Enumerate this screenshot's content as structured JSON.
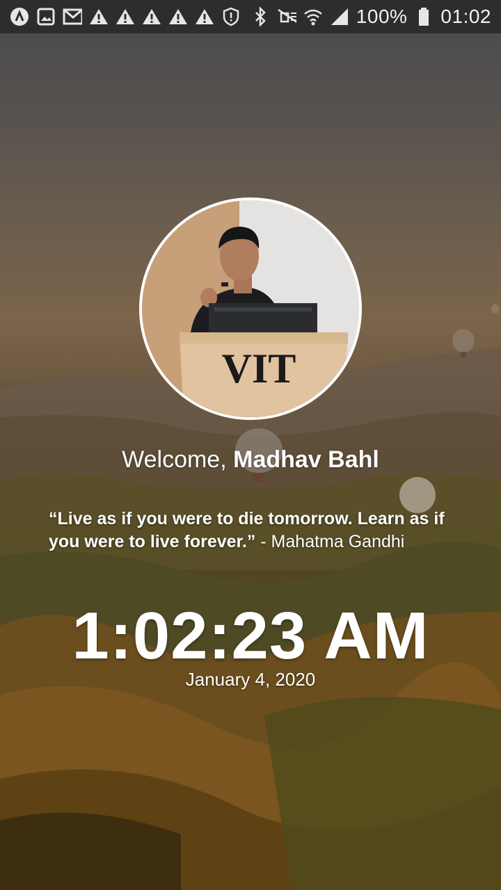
{
  "status_bar": {
    "battery": "100%",
    "time": "01:02",
    "left_icons": [
      "app-a-icon",
      "image-icon",
      "gmail-icon",
      "warning-icon",
      "warning-icon",
      "warning-icon",
      "warning-icon",
      "warning-icon",
      "shield-icon"
    ],
    "right_icons": [
      "bluetooth-icon",
      "mute-icon",
      "wifi-icon",
      "signal-icon",
      "battery-icon"
    ]
  },
  "profile": {
    "welcome_prefix": "Welcome,",
    "name": "Madhav Bahl",
    "podium_text": "VIT"
  },
  "quote": {
    "text": "“Live as if you were to die tomorrow. Learn as if you were to live forever.”",
    "author": " - Mahatma Gandhi"
  },
  "clock": {
    "time": "1:02:23 AM",
    "date": "January 4, 2020"
  }
}
